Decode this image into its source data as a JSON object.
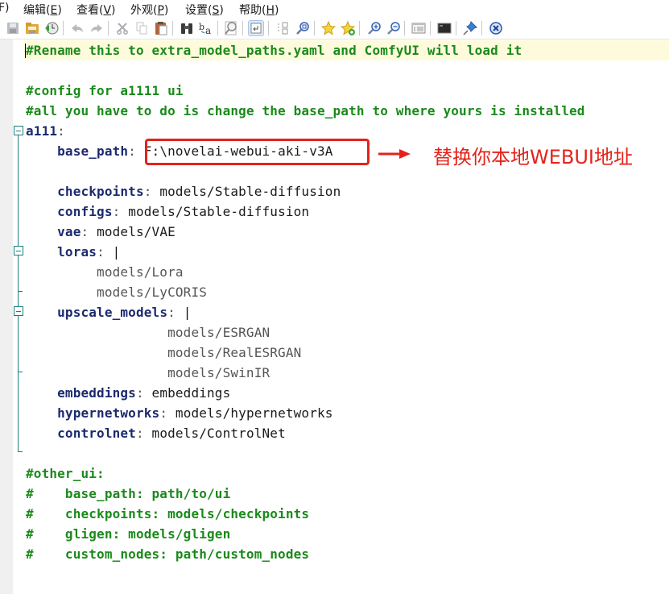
{
  "menubar": {
    "items": [
      {
        "label": "F)",
        "name": "file"
      },
      {
        "label": "编辑(",
        "mnemonic": "E",
        "suffix": ")",
        "name": "edit"
      },
      {
        "label": "查看(",
        "mnemonic": "V",
        "suffix": ")",
        "name": "view"
      },
      {
        "label": "外观(",
        "mnemonic": "P",
        "suffix": ")",
        "name": "appearance"
      },
      {
        "label": "设置(",
        "mnemonic": "S",
        "suffix": ")",
        "name": "settings"
      },
      {
        "label": "帮助(",
        "mnemonic": "H",
        "suffix": ")",
        "name": "help"
      }
    ]
  },
  "toolbar": {
    "buttons": [
      {
        "icon": "save-icon",
        "tooltip": "Save"
      },
      {
        "icon": "open-folder-icon",
        "tooltip": "Open"
      },
      {
        "icon": "reload-history-icon",
        "tooltip": "Reload"
      },
      {
        "icon": "undo-icon",
        "tooltip": "Undo"
      },
      {
        "icon": "redo-icon",
        "tooltip": "Redo"
      },
      {
        "icon": "cut-icon",
        "tooltip": "Cut"
      },
      {
        "icon": "copy-icon",
        "tooltip": "Copy"
      },
      {
        "icon": "paste-icon",
        "tooltip": "Paste"
      },
      {
        "icon": "find-binoculars-icon",
        "tooltip": "Find"
      },
      {
        "icon": "replace-icon",
        "tooltip": "Replace"
      },
      {
        "icon": "zoom-page-icon",
        "tooltip": "Zoom"
      },
      {
        "icon": "word-wrap-icon",
        "tooltip": "Word Wrap",
        "active": true
      },
      {
        "icon": "compare-docs-icon",
        "tooltip": "Compare"
      },
      {
        "icon": "find-target-icon",
        "tooltip": "Find in files"
      },
      {
        "icon": "star-bookmark-icon",
        "tooltip": "Favorites"
      },
      {
        "icon": "star-add-icon",
        "tooltip": "Add favorite"
      },
      {
        "icon": "zoom-in-icon",
        "tooltip": "Zoom in"
      },
      {
        "icon": "zoom-out-icon",
        "tooltip": "Zoom out"
      },
      {
        "icon": "window-list-icon",
        "tooltip": "Window"
      },
      {
        "icon": "terminal-icon",
        "tooltip": "Command prompt"
      },
      {
        "icon": "pin-icon",
        "tooltip": "Always on top"
      },
      {
        "icon": "close-circle-icon",
        "tooltip": "Exit"
      }
    ]
  },
  "editor": {
    "lines": [
      {
        "segments": [
          {
            "t": "#Rename this to extra_model_paths.yaml and ComfyUI will load it",
            "c": "comment"
          }
        ]
      },
      {
        "segments": []
      },
      {
        "segments": [
          {
            "t": "#config for a1111 ui",
            "c": "comment"
          }
        ]
      },
      {
        "segments": [
          {
            "t": "#all you have to do is change the base_path to where yours is installed",
            "c": "comment"
          }
        ]
      },
      {
        "segments": [
          {
            "t": "a111",
            "c": "key"
          },
          {
            "t": ":",
            "c": "punct"
          }
        ]
      },
      {
        "segments": [
          {
            "t": "    "
          },
          {
            "t": "base_path",
            "c": "key"
          },
          {
            "t": ": ",
            "c": "punct"
          },
          {
            "t": "F:\\novelai-webui-aki-v3A",
            "c": "val"
          }
        ]
      },
      {
        "segments": []
      },
      {
        "segments": [
          {
            "t": "    "
          },
          {
            "t": "checkpoints",
            "c": "key"
          },
          {
            "t": ": ",
            "c": "punct"
          },
          {
            "t": "models/Stable-diffusion",
            "c": "val"
          }
        ]
      },
      {
        "segments": [
          {
            "t": "    "
          },
          {
            "t": "configs",
            "c": "key"
          },
          {
            "t": ": ",
            "c": "punct"
          },
          {
            "t": "models/Stable-diffusion",
            "c": "val"
          }
        ]
      },
      {
        "segments": [
          {
            "t": "    "
          },
          {
            "t": "vae",
            "c": "key"
          },
          {
            "t": ": ",
            "c": "punct"
          },
          {
            "t": "models/VAE",
            "c": "val"
          }
        ]
      },
      {
        "segments": [
          {
            "t": "    "
          },
          {
            "t": "loras",
            "c": "key"
          },
          {
            "t": ": ",
            "c": "punct"
          },
          {
            "t": "|",
            "c": "pipe"
          }
        ]
      },
      {
        "segments": [
          {
            "t": "         "
          },
          {
            "t": "models/Lora",
            "c": "block"
          }
        ]
      },
      {
        "segments": [
          {
            "t": "         "
          },
          {
            "t": "models/LyCORIS",
            "c": "block"
          }
        ]
      },
      {
        "segments": [
          {
            "t": "    "
          },
          {
            "t": "upscale_models",
            "c": "key"
          },
          {
            "t": ": ",
            "c": "punct"
          },
          {
            "t": "|",
            "c": "pipe"
          }
        ]
      },
      {
        "segments": [
          {
            "t": "                  "
          },
          {
            "t": "models/ESRGAN",
            "c": "block"
          }
        ]
      },
      {
        "segments": [
          {
            "t": "                  "
          },
          {
            "t": "models/RealESRGAN",
            "c": "block"
          }
        ]
      },
      {
        "segments": [
          {
            "t": "                  "
          },
          {
            "t": "models/SwinIR",
            "c": "block"
          }
        ]
      },
      {
        "segments": [
          {
            "t": "    "
          },
          {
            "t": "embeddings",
            "c": "key"
          },
          {
            "t": ": ",
            "c": "punct"
          },
          {
            "t": "embeddings",
            "c": "val"
          }
        ]
      },
      {
        "segments": [
          {
            "t": "    "
          },
          {
            "t": "hypernetworks",
            "c": "key"
          },
          {
            "t": ": ",
            "c": "punct"
          },
          {
            "t": "models/hypernetworks",
            "c": "val"
          }
        ]
      },
      {
        "segments": [
          {
            "t": "    "
          },
          {
            "t": "controlnet",
            "c": "key"
          },
          {
            "t": ": ",
            "c": "punct"
          },
          {
            "t": "models/ControlNet",
            "c": "val"
          }
        ]
      },
      {
        "segments": []
      },
      {
        "segments": [
          {
            "t": "#other_ui:",
            "c": "comment"
          }
        ]
      },
      {
        "segments": [
          {
            "t": "#    base_path: path/to/ui",
            "c": "comment"
          }
        ]
      },
      {
        "segments": [
          {
            "t": "#    checkpoints: models/checkpoints",
            "c": "comment"
          }
        ]
      },
      {
        "segments": [
          {
            "t": "#    gligen: models/gligen",
            "c": "comment"
          }
        ]
      },
      {
        "segments": [
          {
            "t": "#    custom_nodes: path/custom_nodes",
            "c": "comment"
          }
        ]
      }
    ]
  },
  "annotation": {
    "text": "替换你本地WEBUI地址",
    "color": "#e3231b"
  },
  "colors": {
    "comment": "#1b8a1b",
    "key": "#1c2a6e",
    "current_line": "#fefbdc",
    "fold": "#1d7e7e"
  }
}
